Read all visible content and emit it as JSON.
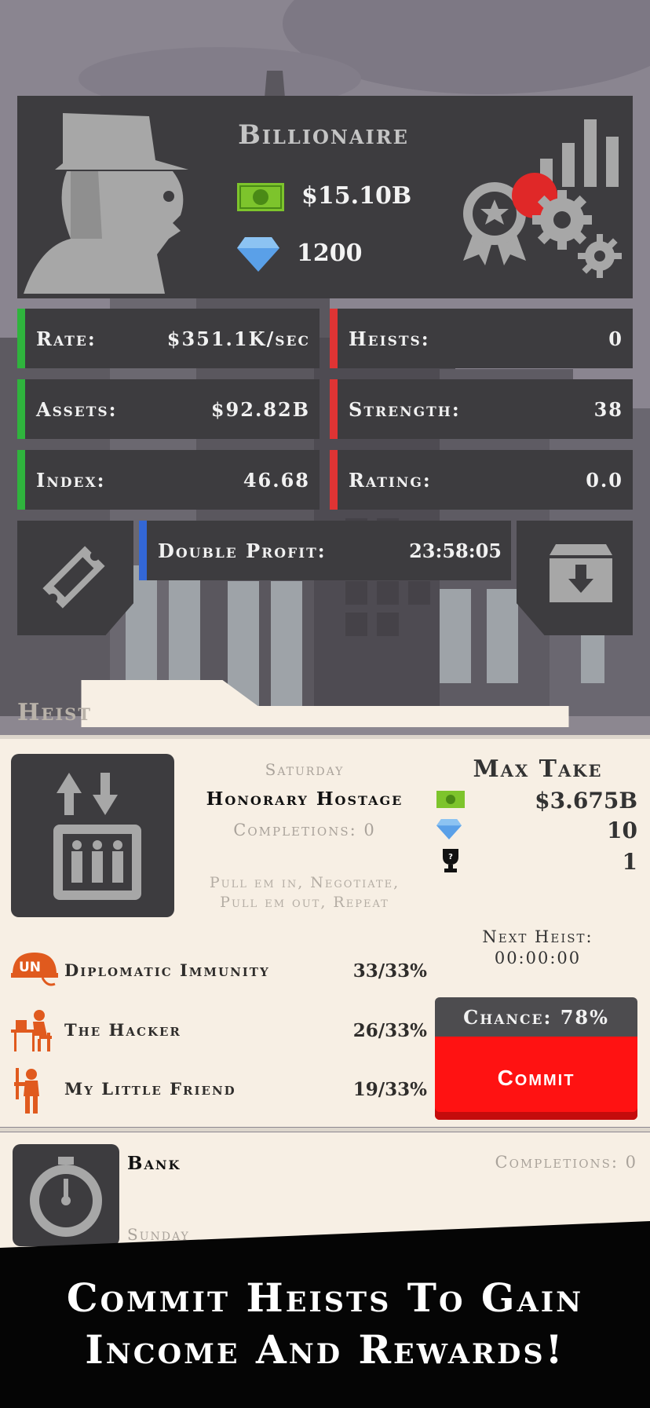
{
  "profile": {
    "rank": "Billionaire",
    "cash": "$15.10B",
    "gems": "1200"
  },
  "stats": {
    "rate_label": "Rate:",
    "rate_value": "$351.1K/sec",
    "heists_label": "Heists:",
    "heists_value": "0",
    "assets_label": "Assets:",
    "assets_value": "$92.82B",
    "strength_label": "Strength:",
    "strength_value": "38",
    "index_label": "Index:",
    "index_value": "46.68",
    "rating_label": "Rating:",
    "rating_value": "0.0",
    "double_profit_label": "Double Profit:",
    "double_profit_value": "23:58:05"
  },
  "heist_section": {
    "title": "Heist"
  },
  "heist": {
    "day": "Saturday",
    "name": "Honorary Hostage",
    "completions": "Completions: 0",
    "description_line1": "Pull em in, Negotiate,",
    "description_line2": "Pull em out, Repeat",
    "max_take_label": "Max Take",
    "take_cash": "$3.675B",
    "take_gems": "10",
    "take_trophy": "1",
    "next_heist_label": "Next Heist:",
    "next_heist_time": "00:00:00",
    "chance": "Chance: 78%",
    "commit_label": "Commit",
    "crew": [
      {
        "name": "Diplomatic Immunity",
        "pct": "33/33%",
        "icon": "un-helmet-icon"
      },
      {
        "name": "The Hacker",
        "pct": "26/33%",
        "icon": "hacker-icon"
      },
      {
        "name": "My Little Friend",
        "pct": "19/33%",
        "icon": "gunman-icon"
      }
    ]
  },
  "next_card": {
    "name": "Bank",
    "completions": "Completions: 0",
    "day": "Sunday"
  },
  "banner": {
    "line1": "Commit Heists To Gain",
    "line2": "Income And Rewards!"
  },
  "colors": {
    "panel": "#3d3c3f",
    "green": "#2fb43d",
    "red": "#df3434",
    "blue": "#3367d6",
    "commit": "#ff1212",
    "cream": "#f7efe4",
    "crew_icon": "#e05a1e"
  }
}
